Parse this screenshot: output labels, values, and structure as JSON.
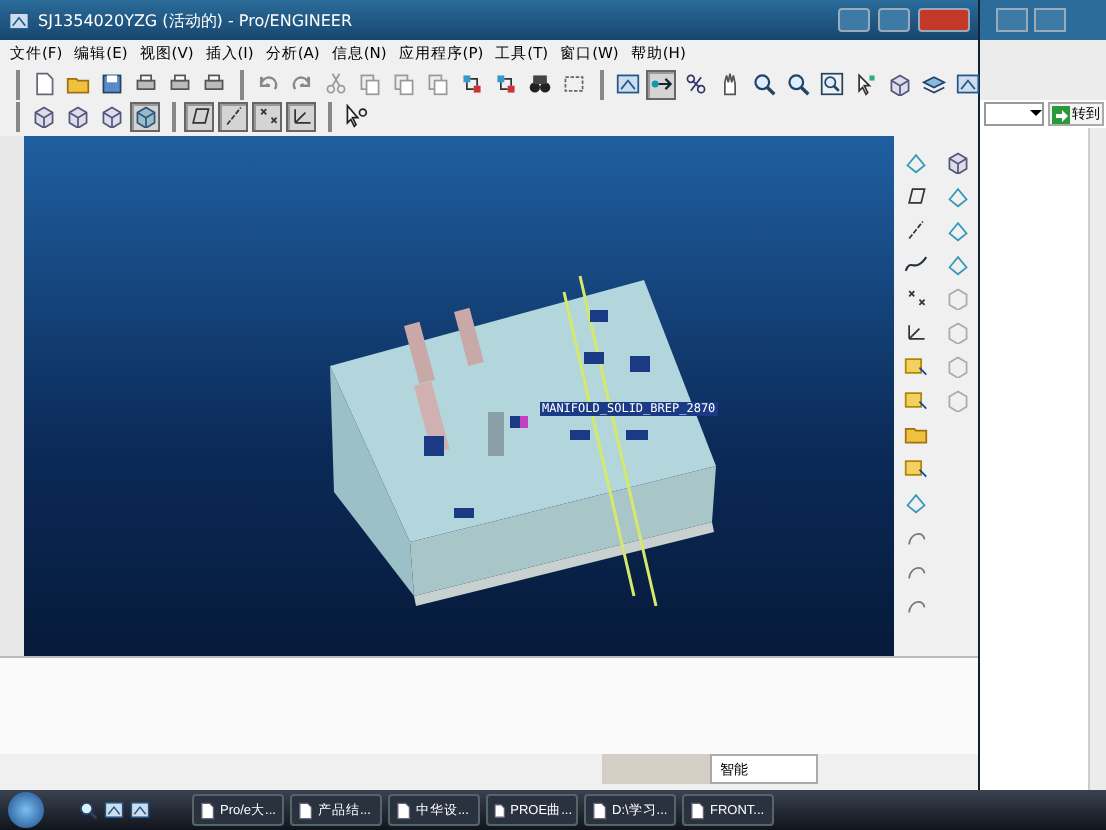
{
  "window": {
    "title": "SJ1354020YZG (活动的) - Pro/ENGINEER"
  },
  "menu": [
    "文件(F)",
    "编辑(E)",
    "视图(V)",
    "插入(I)",
    "分析(A)",
    "信息(N)",
    "应用程序(P)",
    "工具(T)",
    "窗口(W)",
    "帮助(H)"
  ],
  "toolbar_rows": [
    {
      "groups": [
        [
          {
            "pressed": false
          },
          {
            "pressed": false
          },
          {
            "pressed": false
          },
          {
            "pressed": false
          },
          {
            "pressed": false
          },
          {
            "pressed": false
          }
        ],
        [
          {
            "pressed": false
          },
          {
            "pressed": false
          },
          {
            "pressed": false
          },
          {
            "pressed": false
          },
          {
            "pressed": false
          },
          {
            "pressed": false
          },
          {
            "pressed": false
          },
          {
            "pressed": false
          },
          {
            "pressed": false
          },
          {
            "pressed": false
          }
        ],
        [
          {
            "pressed": false
          },
          {
            "pressed": true
          },
          {
            "pressed": false
          },
          {
            "pressed": false
          },
          {
            "pressed": false
          },
          {
            "pressed": false
          },
          {
            "pressed": false
          },
          {
            "pressed": false
          },
          {
            "pressed": false
          },
          {
            "pressed": false
          },
          {
            "pressed": false
          }
        ]
      ]
    },
    {
      "groups": [
        [
          {
            "pressed": false
          },
          {
            "pressed": false
          },
          {
            "pressed": false
          },
          {
            "pressed": true
          }
        ],
        [
          {
            "pressed": true
          },
          {
            "pressed": true
          },
          {
            "pressed": true
          },
          {
            "pressed": true
          }
        ],
        [
          {
            "pressed": false
          }
        ]
      ]
    }
  ],
  "graphics": {
    "labels": [
      "MANIFOLD_SOLID_BREP_2870"
    ]
  },
  "status_bar": {
    "filter": "智能"
  },
  "background_window": {
    "go_button": "转到"
  },
  "taskbar": {
    "items": [
      "Pro/e大...",
      "产品结...",
      "中华设...",
      "PROE曲...",
      "D:\\学习...",
      "FRONT..."
    ]
  }
}
